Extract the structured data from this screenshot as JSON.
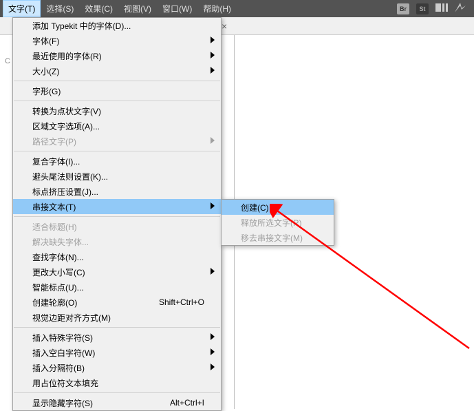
{
  "menubar": {
    "items": [
      {
        "label": "文字(T)"
      },
      {
        "label": "选择(S)"
      },
      {
        "label": "效果(C)"
      },
      {
        "label": "视图(V)"
      },
      {
        "label": "窗口(W)"
      },
      {
        "label": "帮助(H)"
      }
    ]
  },
  "topIcons": {
    "br": "Br",
    "st": "St"
  },
  "docbar": {
    "close": "×"
  },
  "leftLetter": "C",
  "dropdown": {
    "group1": [
      {
        "label": "添加 Typekit 中的字体(D)...",
        "arrow": false
      },
      {
        "label": "字体(F)",
        "arrow": true
      },
      {
        "label": "最近使用的字体(R)",
        "arrow": true
      },
      {
        "label": "大小(Z)",
        "arrow": true
      }
    ],
    "group2": [
      {
        "label": "字形(G)",
        "arrow": false
      }
    ],
    "group3": [
      {
        "label": "转换为点状文字(V)",
        "arrow": false
      },
      {
        "label": "区域文字选项(A)...",
        "arrow": false
      },
      {
        "label": "路径文字(P)",
        "arrow": true,
        "disabled": true
      }
    ],
    "group4": [
      {
        "label": "复合字体(I)...",
        "arrow": false
      },
      {
        "label": "避头尾法则设置(K)...",
        "arrow": false
      },
      {
        "label": "标点挤压设置(J)...",
        "arrow": false
      },
      {
        "label": "串接文本(T)",
        "arrow": true,
        "highlighted": true
      }
    ],
    "group5": [
      {
        "label": "适合标题(H)",
        "arrow": false,
        "disabled": true
      },
      {
        "label": "解决缺失字体...",
        "arrow": false,
        "disabled": true
      },
      {
        "label": "查找字体(N)...",
        "arrow": false
      },
      {
        "label": "更改大小写(C)",
        "arrow": true
      },
      {
        "label": "智能标点(U)...",
        "arrow": false
      },
      {
        "label": "创建轮廓(O)",
        "arrow": false,
        "shortcut": "Shift+Ctrl+O"
      },
      {
        "label": "视觉边距对齐方式(M)",
        "arrow": false
      }
    ],
    "group6": [
      {
        "label": "插入特殊字符(S)",
        "arrow": true
      },
      {
        "label": "插入空白字符(W)",
        "arrow": true
      },
      {
        "label": "插入分隔符(B)",
        "arrow": true
      },
      {
        "label": "用占位符文本填充",
        "arrow": false
      }
    ],
    "group7": [
      {
        "label": "显示隐藏字符(S)",
        "arrow": false,
        "shortcut": "Alt+Ctrl+I"
      }
    ]
  },
  "submenu": {
    "items": [
      {
        "label": "创建(C)",
        "highlighted": true
      },
      {
        "label": "释放所选文字(R)",
        "disabled": true
      },
      {
        "label": "移去串接文字(M)",
        "disabled": true
      }
    ]
  }
}
